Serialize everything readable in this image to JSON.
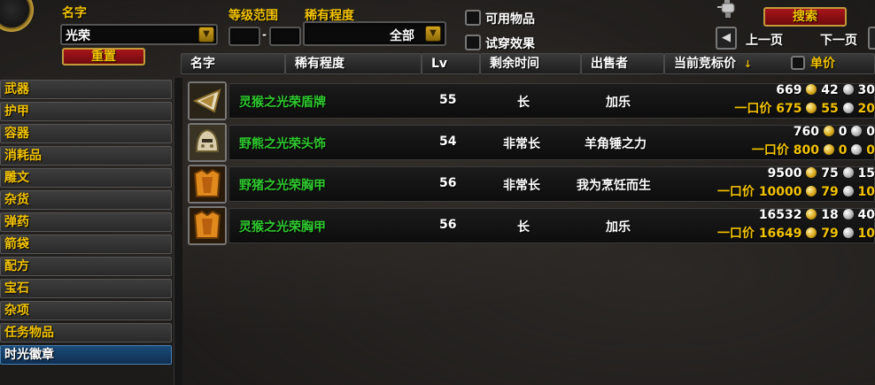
{
  "search": {
    "name_label": "名字",
    "name_value": "光荣",
    "level_range_label": "等级范围",
    "level_min": "",
    "level_max": "",
    "level_dash": "-",
    "rarity_label": "稀有程度",
    "rarity_value": "全部",
    "reset_label": "重置",
    "usable_label": "可用物品",
    "tryon_label": "试穿效果",
    "search_label": "搜索",
    "prev_label": "上一页",
    "next_label": "下一页"
  },
  "columns": {
    "name": "名字",
    "rarity": "稀有程度",
    "lv": "Lv",
    "time_left": "剩余时间",
    "seller": "出售者",
    "current_bid": "当前竞标价",
    "sort_arrow": "↓",
    "unit_price": "单价"
  },
  "sidebar": {
    "items": [
      {
        "label": "武器"
      },
      {
        "label": "护甲"
      },
      {
        "label": "容器"
      },
      {
        "label": "消耗品"
      },
      {
        "label": "雕文"
      },
      {
        "label": "杂货"
      },
      {
        "label": "弹药"
      },
      {
        "label": "箭袋"
      },
      {
        "label": "配方"
      },
      {
        "label": "宝石"
      },
      {
        "label": "杂项"
      },
      {
        "label": "任务物品"
      },
      {
        "label": "时光徽章"
      }
    ]
  },
  "rows": [
    {
      "icon": "shield-badge-icon",
      "name": "灵猴之光荣盾牌",
      "level": "55",
      "time": "长",
      "seller": "加乐",
      "buyout_label": "一口价",
      "bid": {
        "gold": "669",
        "silver": "42",
        "copper": "30"
      },
      "buyout": {
        "gold": "675",
        "silver": "55",
        "copper": "20"
      }
    },
    {
      "icon": "helmet-icon",
      "name": "野熊之光荣头饰",
      "level": "54",
      "time": "非常长",
      "seller": "羊角锤之力",
      "buyout_label": "一口价",
      "bid": {
        "gold": "760",
        "silver": "0",
        "copper": "0"
      },
      "buyout": {
        "gold": "800",
        "silver": "0",
        "copper": "0"
      }
    },
    {
      "icon": "chest-armor-icon",
      "name": "野猪之光荣胸甲",
      "level": "56",
      "time": "非常长",
      "seller": "我为烹饪而生",
      "buyout_label": "一口价",
      "bid": {
        "gold": "9500",
        "silver": "75",
        "copper": "15"
      },
      "buyout": {
        "gold": "10000",
        "silver": "79",
        "copper": "10"
      }
    },
    {
      "icon": "chest-armor-icon",
      "name": "灵猴之光荣胸甲",
      "level": "56",
      "time": "长",
      "seller": "加乐",
      "buyout_label": "一口价",
      "bid": {
        "gold": "16532",
        "silver": "18",
        "copper": "40"
      },
      "buyout": {
        "gold": "16649",
        "silver": "79",
        "copper": "10"
      }
    }
  ],
  "colors": {
    "label_gold": "#f2c200",
    "item_green": "#2ec82e",
    "button_red": "#a8141b",
    "active_blue": "#1b4b78"
  }
}
